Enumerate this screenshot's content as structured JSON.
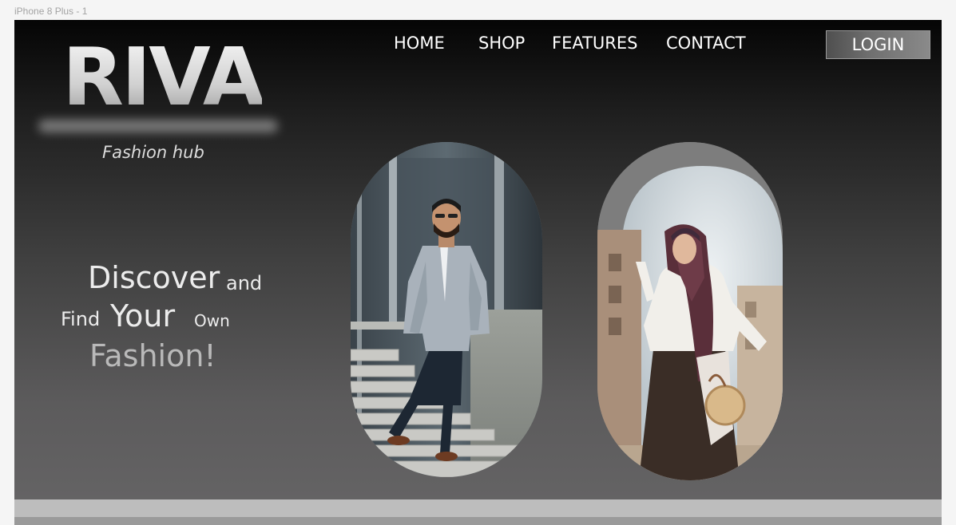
{
  "artboard": {
    "label": "iPhone 8 Plus - 1"
  },
  "brand": {
    "name": "RIVA",
    "tagline": "Fashion hub"
  },
  "nav": {
    "items": [
      {
        "label": "HOME"
      },
      {
        "label": "SHOP"
      },
      {
        "label": "FEATURES"
      },
      {
        "label": "CONTACT"
      }
    ],
    "login_label": "LOGIN"
  },
  "hero": {
    "headline": {
      "discover": "Discover",
      "and": "and",
      "find": "Find",
      "your": "Your",
      "own": "Own",
      "fashion": "Fashion!"
    }
  },
  "images": {
    "left": "man-in-plaid-blazer-on-stairs-photo",
    "right": "woman-in-hijab-with-round-bag-photo"
  },
  "colors": {
    "hero_top": "#050505",
    "hero_bottom": "#646364",
    "text_light": "#ececec",
    "fashion_text": "#b9b9b9",
    "footer_strip": "#bdbdbd"
  }
}
